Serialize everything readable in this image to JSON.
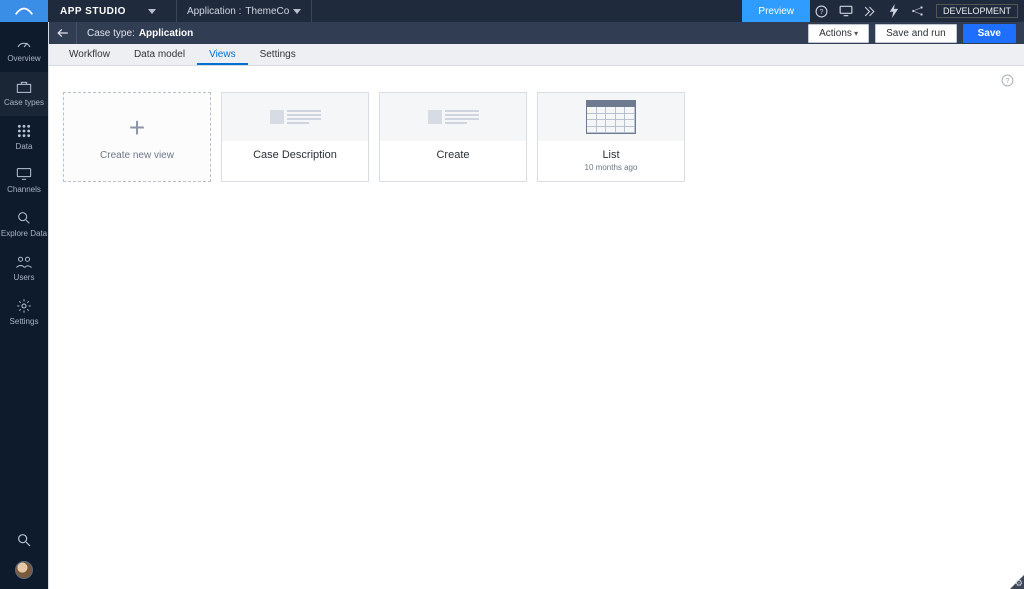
{
  "header": {
    "app_studio": "APP STUDIO",
    "application_prefix": "Application :",
    "application_name": "ThemeCo",
    "preview": "Preview",
    "environment": "DEVELOPMENT"
  },
  "sidebar": {
    "items": [
      {
        "label": "Overview",
        "icon": "gauge"
      },
      {
        "label": "Case types",
        "icon": "case"
      },
      {
        "label": "Data",
        "icon": "grid"
      },
      {
        "label": "Channels",
        "icon": "monitor"
      },
      {
        "label": "Explore Data",
        "icon": "search-data"
      },
      {
        "label": "Users",
        "icon": "users"
      },
      {
        "label": "Settings",
        "icon": "gear"
      }
    ]
  },
  "case_header": {
    "prefix": "Case type:",
    "name": "Application",
    "actions_label": "Actions",
    "save_and_run_label": "Save and run",
    "save_label": "Save"
  },
  "tabs": [
    {
      "label": "Workflow",
      "active": false
    },
    {
      "label": "Data model",
      "active": false
    },
    {
      "label": "Views",
      "active": true
    },
    {
      "label": "Settings",
      "active": false
    }
  ],
  "views": {
    "create_label": "Create new view",
    "cards": [
      {
        "label": "Case Description",
        "meta": "",
        "thumb": "doc"
      },
      {
        "label": "Create",
        "meta": "",
        "thumb": "doc"
      },
      {
        "label": "List",
        "meta": "10 months ago",
        "thumb": "table"
      }
    ]
  }
}
